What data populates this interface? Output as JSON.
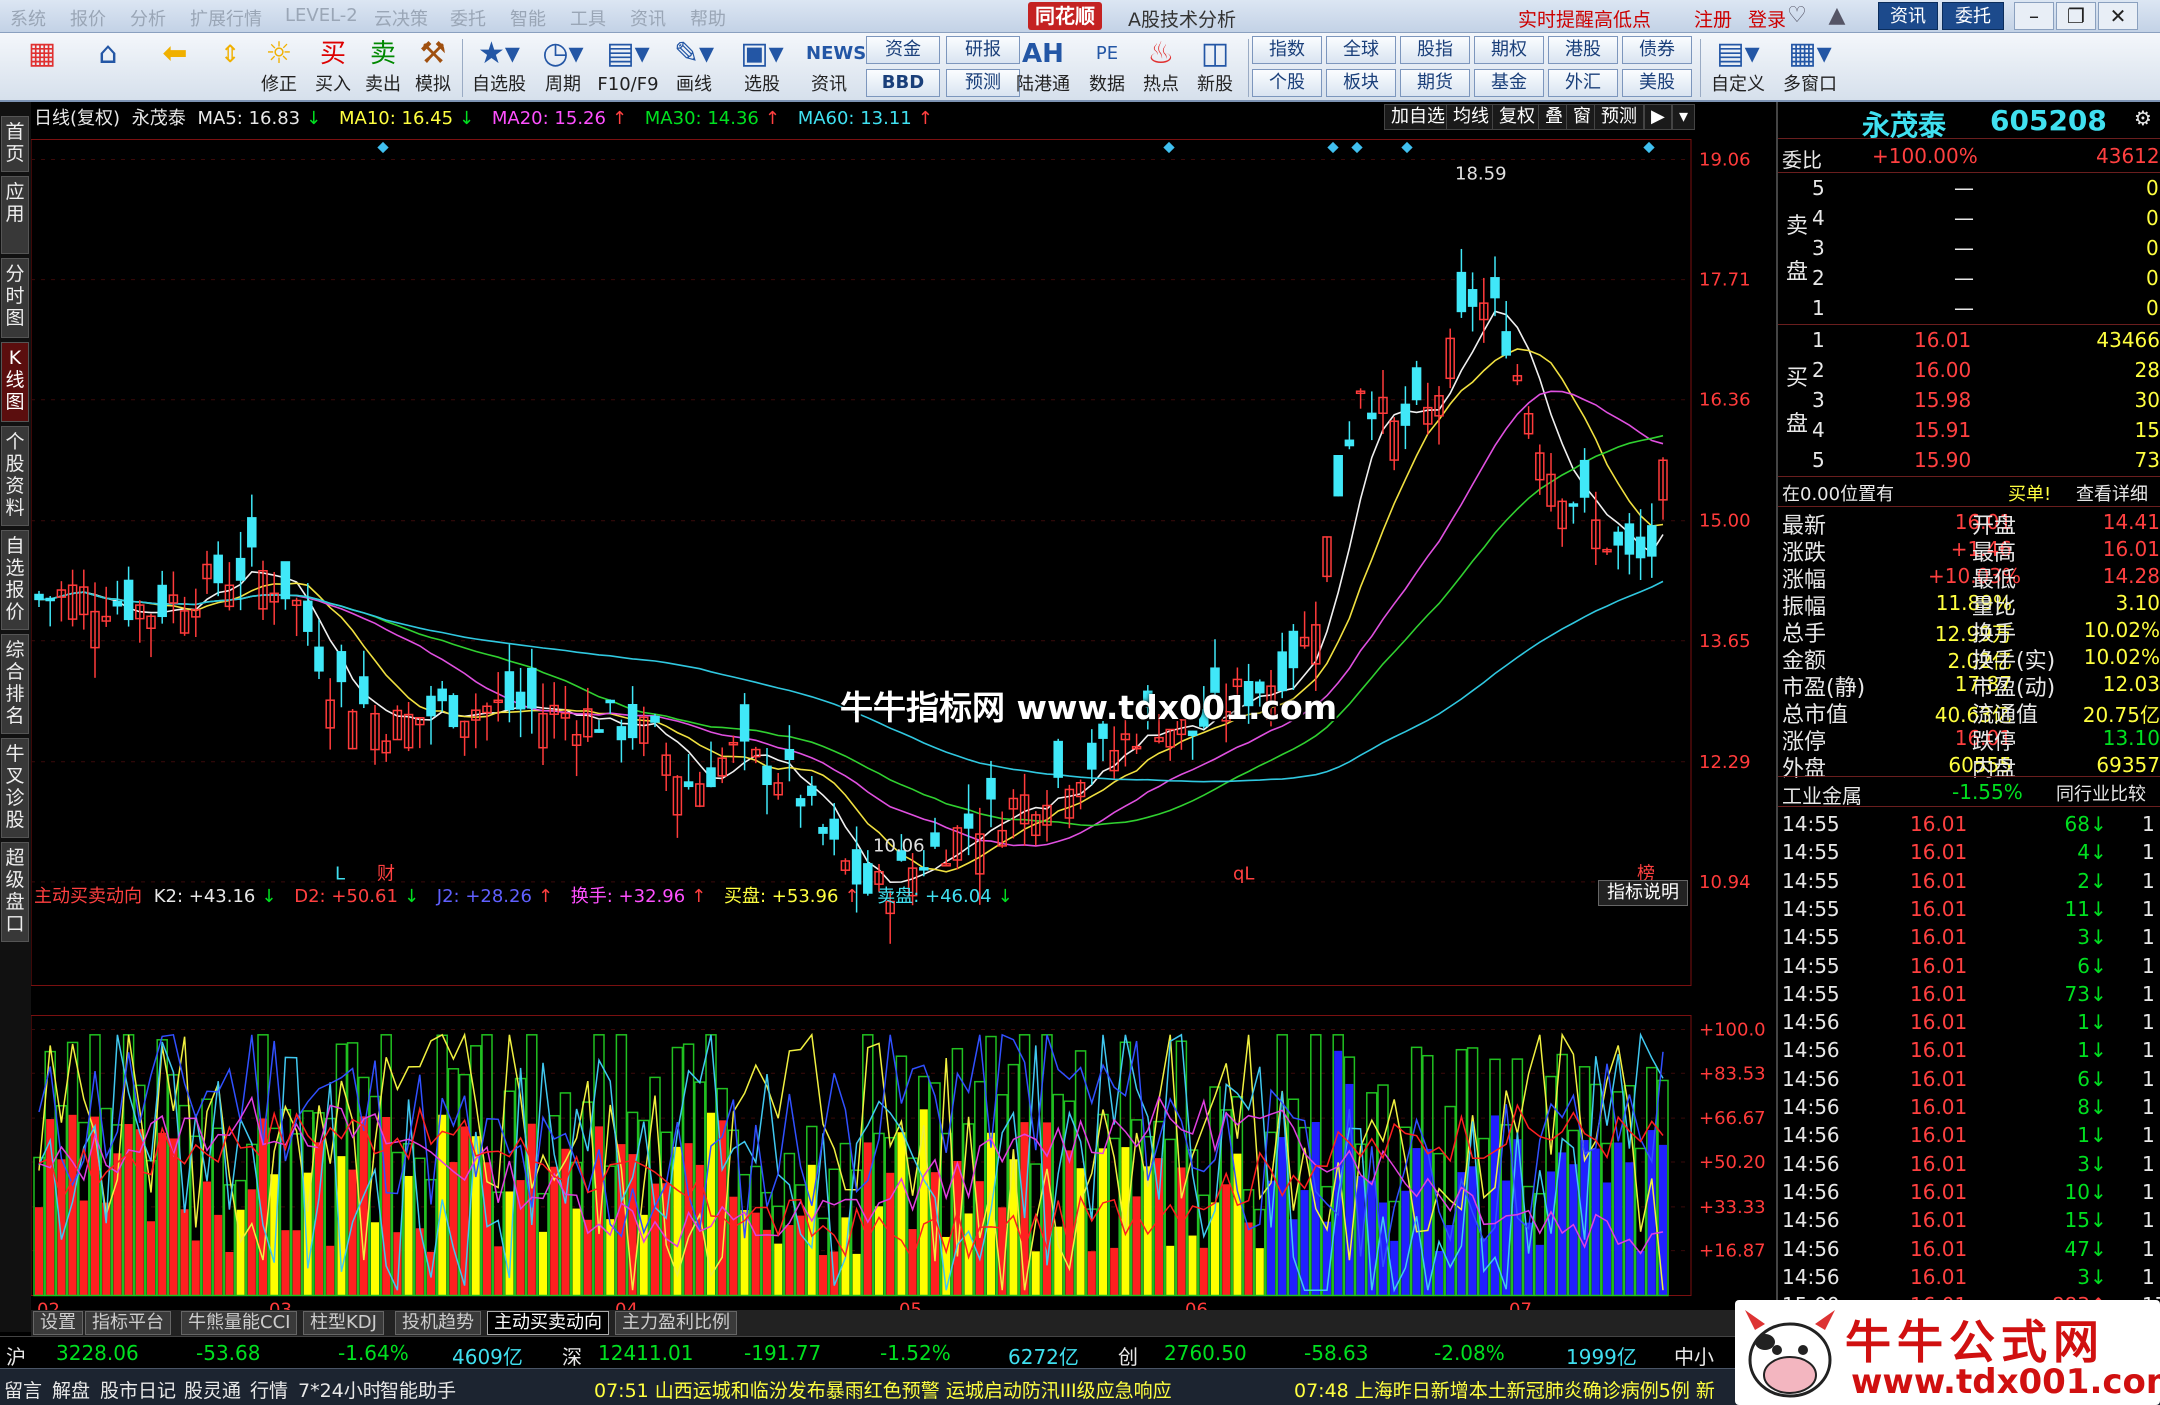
{
  "title": {
    "menus": [
      "系统",
      "报价",
      "分析",
      "扩展行情",
      "LEVEL-2",
      "云决策",
      "委托",
      "智能",
      "工具",
      "资讯",
      "帮助"
    ],
    "brand": "同花顺",
    "app": "A股技术分析",
    "alert": "实时提醒高低点",
    "register": "注册",
    "login": "登录",
    "zixun": "资讯",
    "weituo": "委托"
  },
  "toolbar": {
    "items": [
      "",
      "",
      "修正",
      "买入",
      "卖出",
      "模拟",
      "自选股",
      "周期",
      "F10/F9",
      "画线",
      "选股",
      "资讯",
      "",
      "陆港通",
      "数据",
      "热点",
      "新股"
    ],
    "icons": {
      "buy": "买",
      "sell": "卖",
      "ah": "AH",
      "news": "NEWS"
    },
    "grid": [
      [
        "资金",
        "BBD"
      ],
      [
        "研报",
        "预测"
      ],
      [
        "指数",
        "个股"
      ],
      [
        "全球",
        "板块"
      ],
      [
        "股指",
        "期货"
      ],
      [
        "期权",
        "基金"
      ],
      [
        "港股",
        "外汇"
      ],
      [
        "债券",
        "美股"
      ]
    ],
    "tail": [
      "自定义",
      "多窗口"
    ]
  },
  "lefttabs": [
    "首页",
    "应用",
    "分时图",
    "K线图",
    "个股资料",
    "自选报价",
    "综合排名",
    "牛叉诊股",
    "超级盘口"
  ],
  "kinfo": {
    "period": "日线(复权)",
    "name": "永茂泰",
    "ma5": "MA5: 16.83",
    "ma5a": "↓",
    "ma10": "MA10: 16.45",
    "ma10a": "↓",
    "ma20": "MA20: 15.26",
    "ma20a": "↑",
    "ma30": "MA30: 14.36",
    "ma30a": "↑",
    "ma60": "MA60: 13.11",
    "ma60a": "↑"
  },
  "chartbtns": [
    "加自选",
    "均线",
    "复权",
    "叠",
    "窗",
    "预测"
  ],
  "indicator": {
    "name": "主动买卖动向",
    "k2": "K2: +43.16",
    "k2a": "↓",
    "d2": "D2: +50.61",
    "d2a": "↓",
    "j2": "J2: +28.26",
    "j2a": "↑",
    "hs": "换手: +32.96",
    "hsa": "↑",
    "mp": "买盘: +53.96",
    "mpa": "↑",
    "sp": "卖盘: +46.04",
    "spa": "↓",
    "help": "指标说明"
  },
  "bottomtabs": [
    "设置",
    "指标平台",
    "牛熊量能CCI",
    "柱型KDJ",
    "投机趋势",
    "主动买卖动向",
    "主力盈利比例"
  ],
  "watermark": "牛牛指标网 www.tdx001.com",
  "logo": {
    "text": "牛牛公式网",
    "url": "www.tdx001.com"
  },
  "index_bar": {
    "sh": "沪",
    "sh_v": "3228.06",
    "sh_c": "-53.68",
    "sh_p": "-1.64%",
    "sh_a": "4609亿",
    "sz": "深",
    "sz_v": "12411.01",
    "sz_c": "-191.77",
    "sz_p": "-1.52%",
    "sz_a": "6272亿",
    "cy": "创",
    "cy_v": "2760.50",
    "cy_c": "-58.63",
    "cy_p": "-2.08%",
    "cy_a": "1999亿",
    "tail": "中小"
  },
  "news_bar": {
    "tabs": [
      "留言",
      "解盘",
      "股市日记",
      "股灵通",
      "行情",
      "7*24小时",
      "智能助手"
    ],
    "n1": "07:51 山西运城和临汾发布暴雨红色预警 运城启动防汛III级应急响应",
    "n2": "07:48 上海昨日新增本土新冠肺炎确诊病例5例 新"
  },
  "stock": {
    "name": "永茂泰",
    "code": "605208",
    "weibi_l": "委比",
    "weibi": "+100.00%",
    "weicha": "43612",
    "sell_label": [
      "卖",
      "盘"
    ],
    "buy_label": [
      "买",
      "盘"
    ],
    "sells": [
      [
        "5",
        "—",
        "0"
      ],
      [
        "4",
        "—",
        "0"
      ],
      [
        "3",
        "—",
        "0"
      ],
      [
        "2",
        "—",
        "0"
      ],
      [
        "1",
        "—",
        "0"
      ]
    ],
    "buys": [
      [
        "1",
        "16.01",
        "43466"
      ],
      [
        "2",
        "16.00",
        "28"
      ],
      [
        "3",
        "15.98",
        "30"
      ],
      [
        "4",
        "15.91",
        "15"
      ],
      [
        "5",
        "15.90",
        "73"
      ]
    ],
    "pos": "在0.00位置有",
    "maidan": "买单!",
    "detail": "查看详细",
    "stats": [
      [
        "最新",
        "16.01",
        "开盘",
        "14.41"
      ],
      [
        "涨跌",
        "+1.46",
        "最高",
        "16.01"
      ],
      [
        "涨幅",
        "+10.03%",
        "最低",
        "14.28"
      ],
      [
        "振幅",
        "11.89%",
        "量比",
        "3.10"
      ],
      [
        "总手",
        "12.99万",
        "换手",
        "10.02%"
      ],
      [
        "金额",
        "2.02亿",
        "换手(实)",
        "10.02%"
      ],
      [
        "市盈(静)",
        "17.87",
        "市盈(动)",
        "12.03"
      ],
      [
        "总市值",
        "40.63亿",
        "流通值",
        "20.75亿"
      ],
      [
        "涨停",
        "16.01",
        "跌停",
        "13.10"
      ],
      [
        "外盘",
        "60555",
        "内盘",
        "69357"
      ]
    ],
    "industry": "工业金属",
    "ind_pct": "-1.55%",
    "ind_cmp": "同行业比较",
    "ticks": [
      [
        "14:55",
        "16.01",
        "68",
        "↓",
        "1"
      ],
      [
        "14:55",
        "16.01",
        "4",
        "↓",
        "1"
      ],
      [
        "14:55",
        "16.01",
        "2",
        "↓",
        "1"
      ],
      [
        "14:55",
        "16.01",
        "11",
        "↓",
        "1"
      ],
      [
        "14:55",
        "16.01",
        "3",
        "↓",
        "1"
      ],
      [
        "14:55",
        "16.01",
        "6",
        "↓",
        "1"
      ],
      [
        "14:55",
        "16.01",
        "73",
        "↓",
        "1"
      ],
      [
        "14:56",
        "16.01",
        "1",
        "↓",
        "1"
      ],
      [
        "14:56",
        "16.01",
        "1",
        "↓",
        "1"
      ],
      [
        "14:56",
        "16.01",
        "6",
        "↓",
        "1"
      ],
      [
        "14:56",
        "16.01",
        "8",
        "↓",
        "1"
      ],
      [
        "14:56",
        "16.01",
        "1",
        "↓",
        "1"
      ],
      [
        "14:56",
        "16.01",
        "3",
        "↓",
        "1"
      ],
      [
        "14:56",
        "16.01",
        "10",
        "↓",
        "1"
      ],
      [
        "14:56",
        "16.01",
        "15",
        "↓",
        "1"
      ],
      [
        "14:56",
        "16.01",
        "47",
        "↓",
        "1"
      ],
      [
        "14:56",
        "16.01",
        "3",
        "↓",
        "1"
      ],
      [
        "15:00",
        "16.01",
        "883",
        "↑",
        "17"
      ]
    ]
  },
  "chart_data": {
    "type": "candlestick",
    "price_axis": [
      "19.06",
      "17.71",
      "16.36",
      "15.00",
      "13.65",
      "12.29",
      "10.94"
    ],
    "price_ylim": [
      10.0,
      19.06
    ],
    "high_label": "18.59",
    "low_label": "10.06",
    "ind_axis": [
      "+100.0",
      "+83.53",
      "+66.67",
      "+50.20",
      "+33.33",
      "+16.87"
    ],
    "ind_ylim": [
      0,
      100
    ],
    "months": [
      "02",
      "03",
      "04",
      "05",
      "06",
      "07"
    ],
    "markers": {
      "L1": "L",
      "cai": "财",
      "qL": "qL",
      "bang": "榜"
    }
  }
}
